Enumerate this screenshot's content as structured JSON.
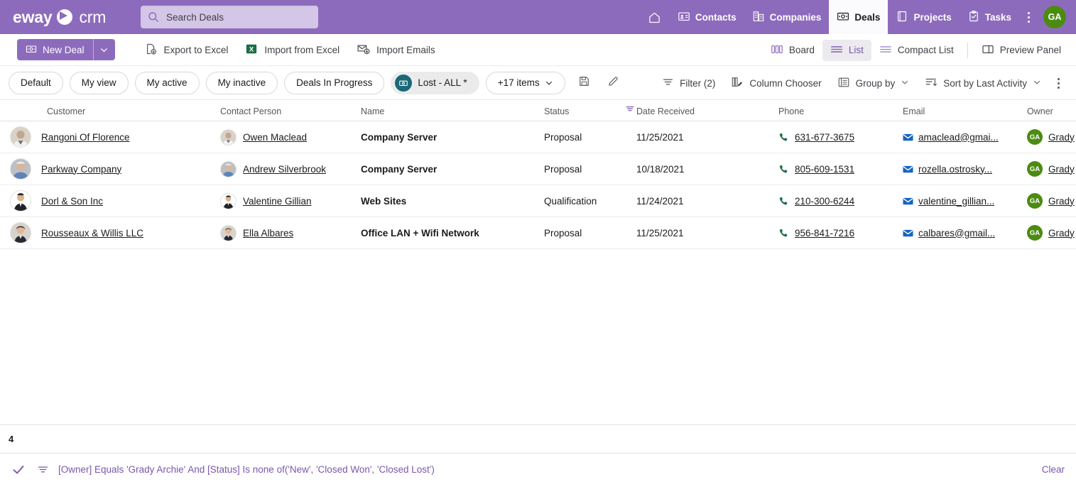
{
  "header": {
    "brand_primary": "eway",
    "brand_secondary": "crm",
    "search_placeholder": "Search Deals",
    "nav": [
      {
        "label": "Contacts",
        "icon": "contact-card-icon",
        "active": false
      },
      {
        "label": "Companies",
        "icon": "building-icon",
        "active": false
      },
      {
        "label": "Deals",
        "icon": "money-icon",
        "active": true
      },
      {
        "label": "Projects",
        "icon": "book-icon",
        "active": false
      },
      {
        "label": "Tasks",
        "icon": "clipboard-check-icon",
        "active": false
      }
    ],
    "avatar_initials": "GA",
    "accent": "#8d6bbc"
  },
  "toolbar": {
    "new_deal_label": "New Deal",
    "actions": [
      {
        "label": "Export to Excel",
        "icon": "export-excel-icon"
      },
      {
        "label": "Import from Excel",
        "icon": "import-excel-icon"
      },
      {
        "label": "Import Emails",
        "icon": "import-emails-icon"
      }
    ],
    "views": [
      {
        "label": "Board",
        "icon": "board-icon",
        "selected": false
      },
      {
        "label": "List",
        "icon": "list-icon",
        "selected": true
      },
      {
        "label": "Compact List",
        "icon": "compact-list-icon",
        "selected": false
      },
      {
        "label": "Preview Panel",
        "icon": "preview-panel-icon",
        "selected": false
      }
    ]
  },
  "chipbar": {
    "chips": [
      {
        "label": "Default",
        "selected": false
      },
      {
        "label": "My view",
        "selected": false
      },
      {
        "label": "My active",
        "selected": false
      },
      {
        "label": "My inactive",
        "selected": false
      },
      {
        "label": "Deals In Progress",
        "selected": false
      },
      {
        "label": "Lost - ALL *",
        "selected": true,
        "badge_color": "#1b6878"
      }
    ],
    "more_label": "+17 items",
    "save_icon": "save-icon",
    "edit_icon": "pencil-icon",
    "right_actions": [
      {
        "label": "Filter (2)",
        "icon": "filter-icon"
      },
      {
        "label": "Column Chooser",
        "icon": "column-chooser-icon"
      },
      {
        "label": "Group by",
        "icon": "group-by-icon",
        "caret": true
      },
      {
        "label": "Sort by Last Activity",
        "icon": "sort-icon",
        "caret": true
      }
    ]
  },
  "grid": {
    "columns": [
      {
        "key": "customer",
        "label": "Customer"
      },
      {
        "key": "contact",
        "label": "Contact Person"
      },
      {
        "key": "name",
        "label": "Name"
      },
      {
        "key": "status",
        "label": "Status",
        "filtered": true
      },
      {
        "key": "date",
        "label": "Date Received"
      },
      {
        "key": "phone",
        "label": "Phone"
      },
      {
        "key": "email",
        "label": "Email"
      },
      {
        "key": "owner",
        "label": "Owner"
      }
    ],
    "rows": [
      {
        "customer": "Rangoni Of Florence",
        "contact": "Owen Maclead",
        "name": "Company Server",
        "status": "Proposal",
        "date": "11/25/2021",
        "phone": "631-677-3675",
        "email": "amaclead@gmai...",
        "owner": "Grady",
        "owner_initials": "GA"
      },
      {
        "customer": "Parkway Company",
        "contact": "Andrew Silverbrook",
        "name": "Company Server",
        "status": "Proposal",
        "date": "10/18/2021",
        "phone": "805-609-1531",
        "email": "rozella.ostrosky...",
        "owner": "Grady",
        "owner_initials": "GA"
      },
      {
        "customer": "Dorl & Son Inc",
        "contact": "Valentine Gillian",
        "name": "Web Sites",
        "status": "Qualification",
        "date": "11/24/2021",
        "phone": "210-300-6244",
        "email": "valentine_gillian...",
        "owner": "Grady",
        "owner_initials": "GA"
      },
      {
        "customer": "Rousseaux & Willis LLC",
        "contact": "Ella Albares",
        "name": "Office LAN + Wifi Network",
        "status": "Proposal",
        "date": "11/25/2021",
        "phone": "956-841-7216",
        "email": "calbares@gmail...",
        "owner": "Grady",
        "owner_initials": "GA"
      }
    ]
  },
  "footer": {
    "record_count": "4",
    "filter_expression": "[Owner] Equals 'Grady Archie' And [Status] Is none of('New', 'Closed Won', 'Closed Lost')",
    "clear_label": "Clear",
    "filter_color": "#7a57ab"
  }
}
